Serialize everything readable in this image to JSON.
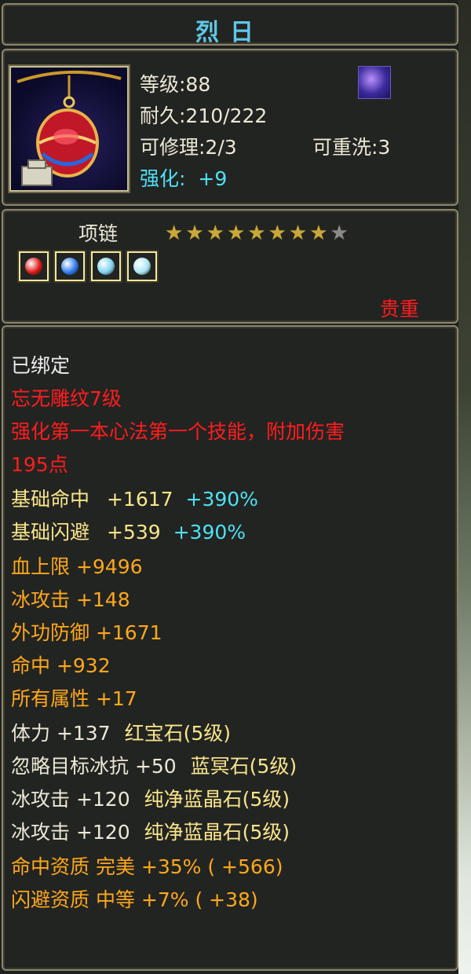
{
  "title": "烈日",
  "info": {
    "level": "等级:88",
    "durability": "耐久:210/222",
    "repairable": "可修理:2/3",
    "rewashable": "可重洗:3",
    "enhance_label": "强化:",
    "enhance_value": "+9",
    "item_icon": "red-gem-necklace-icon",
    "badge_icon": "purple-crystal-icon"
  },
  "sub": {
    "type": "项链",
    "stars_total": 9,
    "stars_lit": 8,
    "gems": [
      {
        "name": "red-gem-icon",
        "color": "#e01818"
      },
      {
        "name": "blue-gem-icon",
        "color": "#2f7cf0"
      },
      {
        "name": "pale-blue-gem-icon",
        "color": "#7fd3ef"
      },
      {
        "name": "pale-blue-gem-icon",
        "color": "#a8e6f5"
      }
    ],
    "rarity": "贵重"
  },
  "details": {
    "bound": "已绑定",
    "engrave": "忘无雕纹7级",
    "engrave_desc_1": "强化第一本心法第一个技能，附加伤害",
    "engrave_desc_2": "195点",
    "hit_base_label": "基础命中",
    "hit_base_value": "+1617",
    "hit_base_pct": "+390%",
    "dodge_base_label": "基础闪避",
    "dodge_base_value": "+539",
    "dodge_base_pct": "+390%",
    "stats": [
      "血上限  +9496",
      "冰攻击  +148",
      "外功防御  +1671",
      "命中  +932",
      "所有属性  +17"
    ],
    "gem_stats": [
      {
        "stat": "体力  +137",
        "gem": "红宝石(5级)"
      },
      {
        "stat": "忽略目标冰抗  +50",
        "gem": "蓝冥石(5级)"
      },
      {
        "stat": "冰攻击  +120",
        "gem": "纯净蓝晶石(5级)"
      },
      {
        "stat": "冰攻击  +120",
        "gem": "纯净蓝晶石(5级)"
      }
    ],
    "quality_1": "命中资质   完美 +35% ( +566)",
    "quality_2": "闪避资质   中等 +7% ( +38)"
  }
}
